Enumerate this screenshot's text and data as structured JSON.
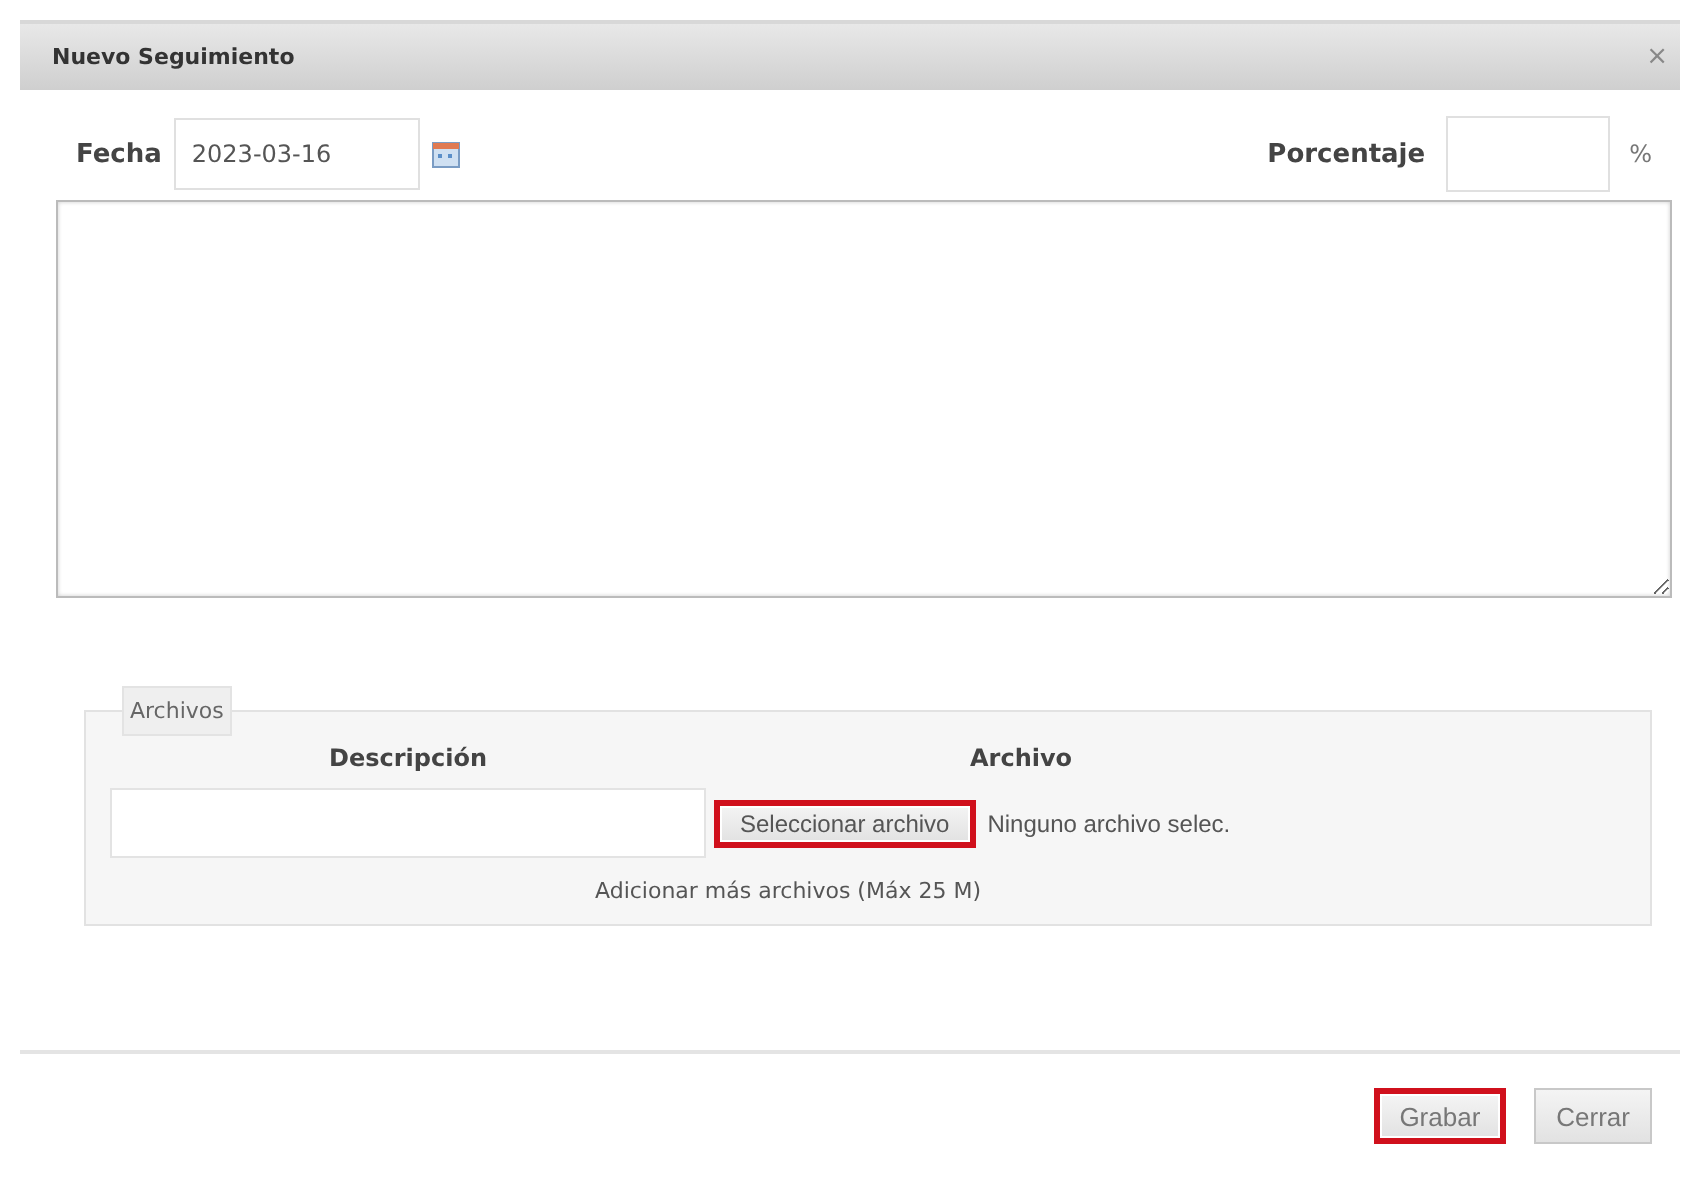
{
  "dialog": {
    "title": "Nuevo Seguimiento",
    "close": "×"
  },
  "fecha": {
    "label": "Fecha",
    "value": "2023-03-16"
  },
  "porcentaje": {
    "label": "Porcentaje",
    "unit": "%"
  },
  "archivos": {
    "legend": "Archivos",
    "columns": [
      "Descripción",
      "Archivo"
    ],
    "rows": [
      {
        "description": "",
        "button": {
          "label": "Seleccionar archivo",
          "highlighted": true
        },
        "status": "Ninguno archivo selec."
      }
    ],
    "add_more": "Adicionar más archivos (Máx 25 M)"
  },
  "buttons": [
    {
      "label": "Grabar",
      "highlighted": true
    },
    {
      "label": "Cerrar",
      "highlighted": false
    }
  ]
}
